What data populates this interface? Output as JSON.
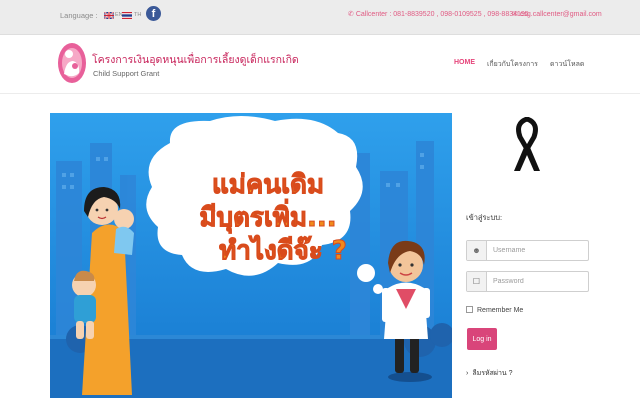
{
  "topbar": {
    "language_label": "Language :",
    "lang_en": "EN",
    "lang_th": "TH",
    "callcenter": "Callcenter : 081-8839520 , 098-0109525 , 098-8834195",
    "email": "csg.callcenter@gmail.com",
    "icons": [
      "flag-uk-icon",
      "flag-thai-icon",
      "facebook-icon",
      "phone-icon",
      "mail-icon"
    ]
  },
  "header": {
    "title": "โครงการเงินอุดหนุนเพื่อการเลี้ยงดูเด็กแรกเกิด",
    "subtitle": "Child Support Grant",
    "nav": [
      {
        "label": "HOME",
        "active": true
      },
      {
        "label": "เกี่ยวกับโครงการ",
        "active": false
      },
      {
        "label": "ดาวน์โหลด",
        "active": false
      }
    ]
  },
  "banner": {
    "line1": "แม่คนเดิม",
    "line2": "มีบุตรเพิ่ม...",
    "line3": "ทำไงดีจ๊ะ ?"
  },
  "login": {
    "heading": "เข้าสู่ระบบ:",
    "username_placeholder": "Username",
    "password_placeholder": "Password",
    "remember_label": "Remember Me",
    "login_button": "Log in",
    "forgot_label": "ลืมรหัสผ่าน ?"
  },
  "colors": {
    "brand_pink": "#d9457a",
    "banner_blue": "#1e8fe3",
    "facebook": "#3b5998"
  }
}
